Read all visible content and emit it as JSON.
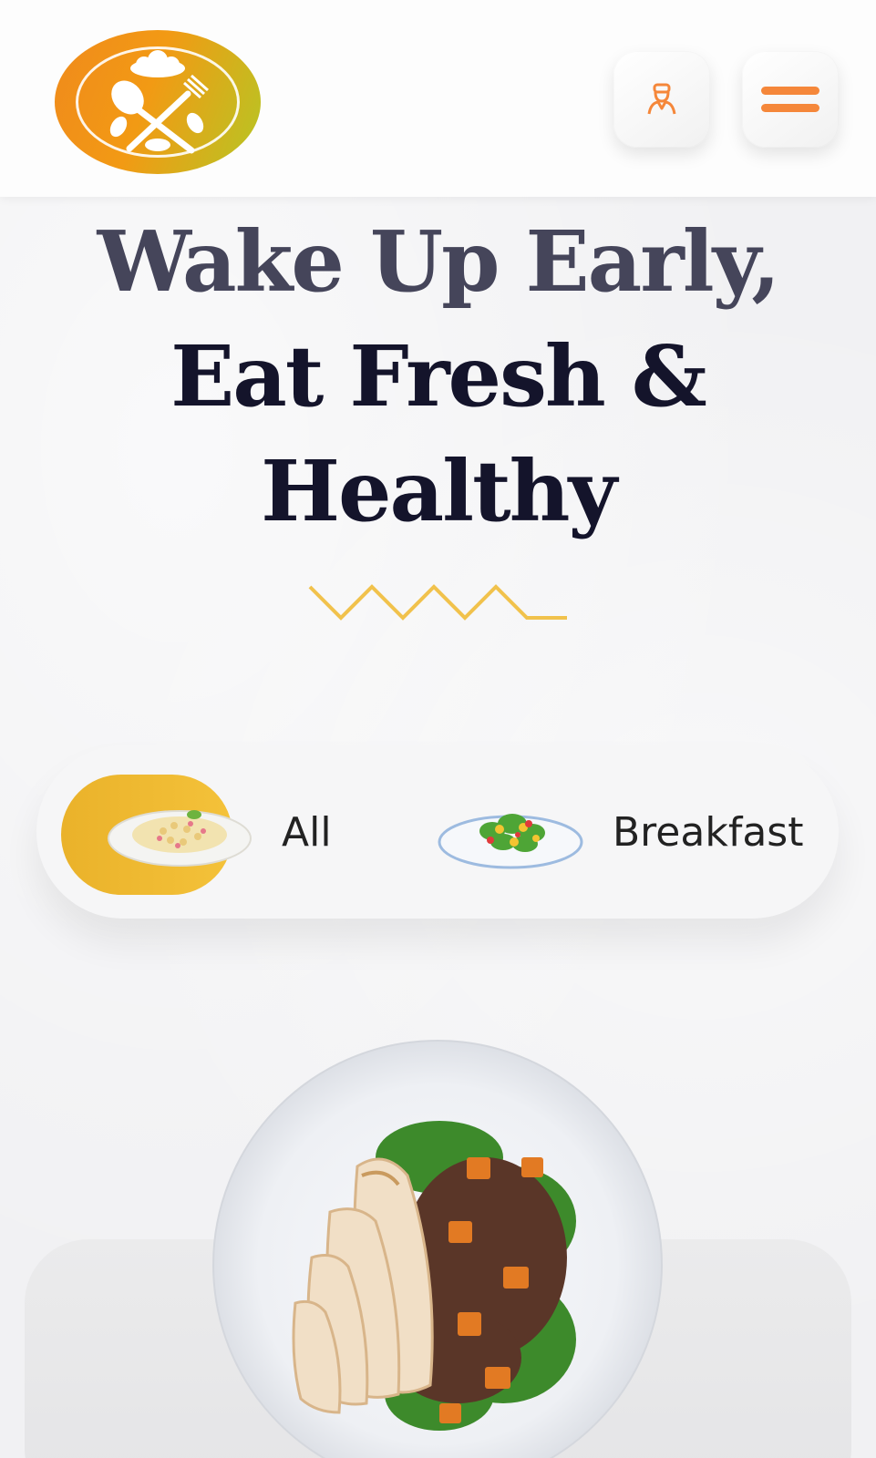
{
  "header": {
    "logo_name": "chef-cutlery-logo",
    "user_icon": "chef-user-icon",
    "menu_icon": "hamburger-menu-icon"
  },
  "hero": {
    "line1": "Wake Up Early,",
    "line2": "Eat Fresh &",
    "line3": "Healthy"
  },
  "categories": [
    {
      "label": "All",
      "icon": "pasta-plate-icon",
      "active": true
    },
    {
      "label": "Breakfast",
      "icon": "salad-plate-icon",
      "active": false
    }
  ],
  "colors": {
    "accent": "#f5873a",
    "yellow": "#f1c24c",
    "title": "#14142b",
    "logo_orange": "#f08a1c",
    "logo_green": "#b6c624"
  }
}
